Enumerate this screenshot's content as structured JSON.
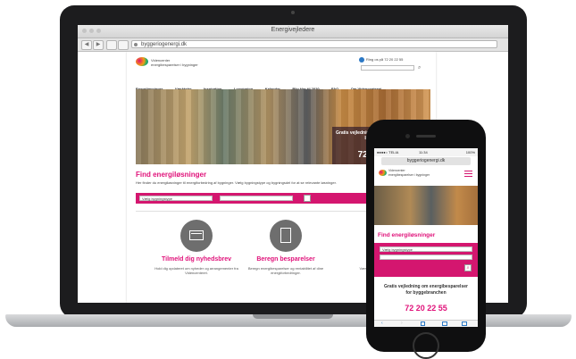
{
  "laptop": {
    "window_title": "Energivejledere",
    "url": "byggeriogenergi.dk",
    "nav_buttons": [
      "◀",
      "▶"
    ],
    "page": {
      "logo_text": [
        "Videncenter",
        "energibesparelser i bygninger"
      ],
      "top_links": "Ring os på 72 20 22 55",
      "search_icon": "search-icon",
      "menu": [
        "Energiløsninger",
        "Værktøjer",
        "Inspiration",
        "Lovgivning",
        "Kalender",
        "Bliv klar til 2020",
        "FAQ",
        "Om Videncenteret"
      ],
      "hero": {
        "headline": "Gratis vejledning om energibesparelser for byggebranchen",
        "phone": "72 20 22 55"
      },
      "find": {
        "title": "Find energiløsninger",
        "description": "Her finder du energiløsninger til energiforbedring af bygninger. Vælg bygningstype og bygningsdel for at se relevante løsninger.",
        "select_left": "Vælg bygningstype",
        "select_right": ""
      },
      "features": [
        {
          "icon": "envelope-icon",
          "title": "Tilmeld dig nyhedsbrev",
          "desc": "Hold dig opdateret om nyheder og arrangementer fra Videncenteret."
        },
        {
          "icon": "calculator-icon",
          "title": "Beregn besparelser",
          "desc": "Beregn energibesparelser og rentabilitet af dine energiforbedringer."
        },
        {
          "icon": "",
          "title": "",
          "desc": "Vær klar til"
        }
      ]
    }
  },
  "phone": {
    "status_left": "●●●●○ TELIA",
    "status_time": "11:34",
    "status_right": "100%",
    "url": "byggeriogenergi.dk",
    "logo_text": [
      "Videncenter",
      "energibesparelser i bygninger"
    ],
    "find_title": "Find energiløsninger",
    "select_left": "Vælg bygningstype",
    "cta_text": "Gratis vejledning om energibesparelser for byggebranchen",
    "cta_phone": "72 20 22 55",
    "bottom_icons": [
      "back-icon",
      "forward-icon",
      "share-icon",
      "book-icon",
      "tabs-icon"
    ]
  },
  "colors": {
    "accent": "#d4166f",
    "title_pink": "#e0127a",
    "dark": "#1c1c1e"
  }
}
